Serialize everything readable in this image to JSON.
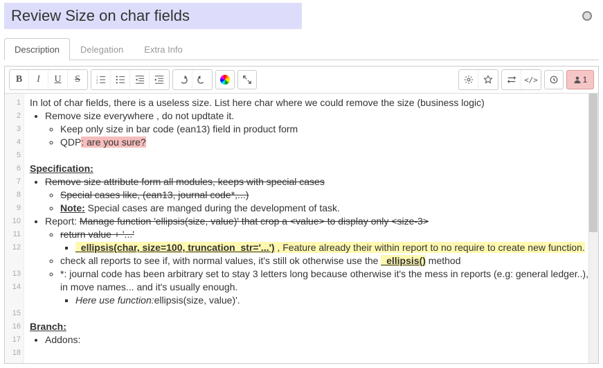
{
  "header": {
    "title": "Review Size on char fields"
  },
  "tabs": [
    {
      "label": "Description",
      "active": true
    },
    {
      "label": "Delegation",
      "active": false
    },
    {
      "label": "Extra Info",
      "active": false
    }
  ],
  "toolbar": {
    "bold": "B",
    "italic": "I",
    "underline": "U",
    "strike": "S",
    "ordered_list": "ol",
    "unordered_list": "ul",
    "outdent": "outdent",
    "indent": "indent",
    "undo": "↶",
    "redo": "↷",
    "color": "color",
    "fullscreen": "⤢",
    "settings": "⚙",
    "star": "☆",
    "swap": "⇄",
    "code": "</>",
    "history": "⟳",
    "users_count": "1"
  },
  "gutter_lines": [
    "1",
    "2",
    "3",
    "4",
    "5",
    "6",
    "7",
    "8",
    "9",
    "10",
    "11",
    "12",
    "",
    "13",
    "14",
    "",
    "15",
    "16",
    "17",
    "18"
  ],
  "doc": {
    "l1": "In lot of char fields, there is a useless size. List here char where we could remove the size (business logic)",
    "l1_e": "e",
    "l2": "Remove size everywhere , do not updtate it.",
    "l3": "Keep only size in bar code (ean13) field in product form",
    "l4a": "QDP",
    "l4b": ": are you sure?",
    "l6": "Specification: ",
    "l7": "Remove size attribute form all modules, keeps with special cases",
    "l8": "Special cases like, (ean13, journal code*,...) ",
    "l9a": "Note:",
    "l9b": " Special cases are manged during the development of task.",
    "l10a": "Report: ",
    "l10b": "Manage function 'ellipsis(size, value)' that crop a <value> to display only <size-3>",
    "l11": "return value + '...'",
    "l12a": "_ellipsis(char, size=100, truncation_str='...')",
    "l12b": " , Feature already their within report to no require to create new function.",
    "l13a": "check all reports to see if, with normal values, it's still ok otherwise use the ",
    "l13b": "_ellipsis()",
    "l13c": " method",
    "l14": "*: journal code has been arbitrary set to stay 3 letters long because otherwise it's the mess in reports (e.g: general ledger..), in move names... and it's usually enough.",
    "l15a": "Here use function:",
    "l15b": "ellipsis(size, value)'.",
    "l17": "Branch:",
    "l18": "Addons:"
  }
}
